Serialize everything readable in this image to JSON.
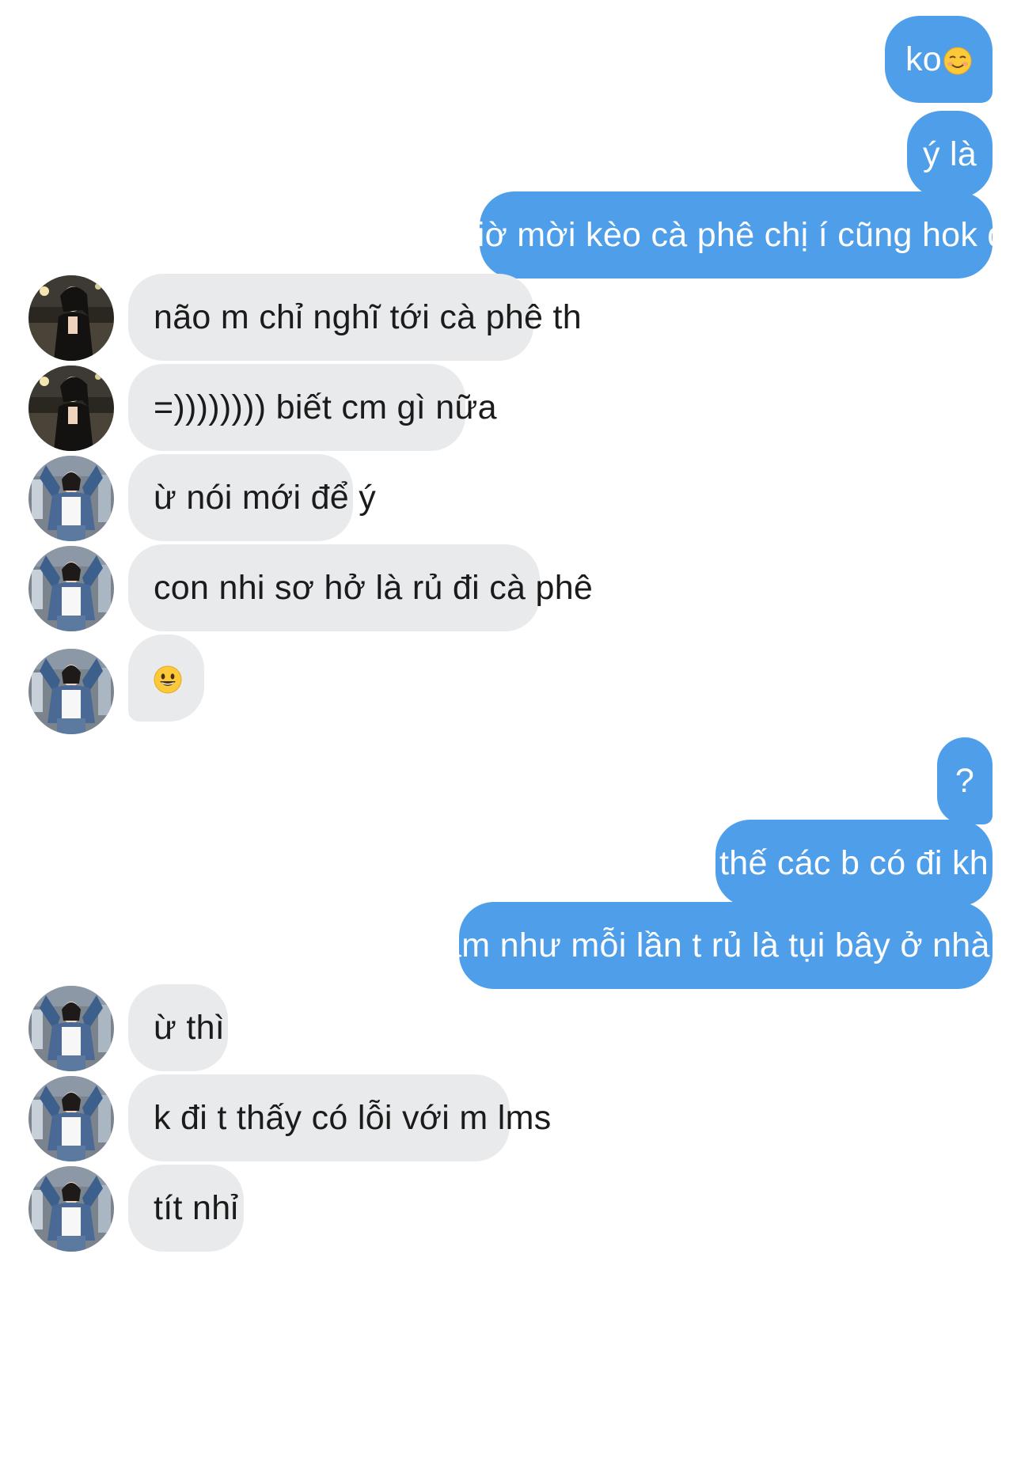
{
  "conversation": {
    "messages": [
      {
        "id": "m1",
        "direction": "outgoing",
        "text": "ko",
        "emoji": "smiling-face-icon"
      },
      {
        "id": "m2",
        "direction": "outgoing",
        "text": "ý là"
      },
      {
        "id": "m3",
        "direction": "outgoing",
        "text": "giờ mời kèo cà phê chị í cũng hok đi"
      },
      {
        "id": "m4",
        "direction": "incoming",
        "avatar": "avatar-a",
        "text": "não m chỉ nghĩ tới cà phê th"
      },
      {
        "id": "m5",
        "direction": "incoming",
        "avatar": "avatar-a",
        "text": "=)))))))) biết cm gì nữa"
      },
      {
        "id": "m6",
        "direction": "incoming",
        "avatar": "avatar-b",
        "text": "ừ nói mới để ý"
      },
      {
        "id": "m7",
        "direction": "incoming",
        "avatar": "avatar-b",
        "text": "con nhi sơ hở là rủ đi cà phê"
      },
      {
        "id": "m8",
        "direction": "incoming",
        "avatar": "avatar-b",
        "text": "😀"
      },
      {
        "id": "m9",
        "direction": "outgoing",
        "text": "?"
      },
      {
        "id": "m10",
        "direction": "outgoing",
        "text": "thế các b có đi kh"
      },
      {
        "id": "m11",
        "direction": "outgoing",
        "text": "làm như mỗi lần t rủ là tụi bây ở nhà v"
      },
      {
        "id": "m12",
        "direction": "incoming",
        "avatar": "avatar-b",
        "text": "ừ thì"
      },
      {
        "id": "m13",
        "direction": "incoming",
        "avatar": "avatar-b",
        "text": "k đi t thấy có lỗi với m lms"
      },
      {
        "id": "m14",
        "direction": "incoming",
        "avatar": "avatar-b",
        "text": "tít nhỉ"
      }
    ]
  },
  "colors": {
    "outgoing_bubble": "#4e9ee9",
    "incoming_bubble": "#e9eaec",
    "outgoing_text": "#ffffff",
    "incoming_text": "#1b1b1b",
    "background": "#ffffff"
  }
}
